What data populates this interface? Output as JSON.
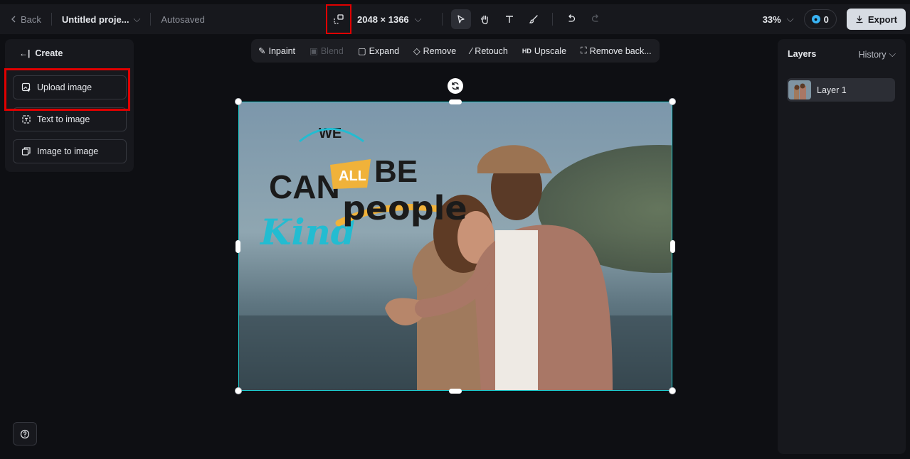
{
  "topbar": {
    "back_label": "Back",
    "project_title": "Untitled proje...",
    "autosave_status": "Autosaved",
    "canvas_size": "2048 × 1366",
    "zoom_level": "33%",
    "credits": "0",
    "export_label": "Export"
  },
  "left_panel": {
    "create_label": "Create",
    "upload_label": "Upload image",
    "text_to_image_label": "Text to image",
    "image_to_image_label": "Image to image"
  },
  "edit_toolbar": {
    "inpaint": "Inpaint",
    "blend": "Blend",
    "expand": "Expand",
    "remove": "Remove",
    "retouch": "Retouch",
    "upscale_badge": "HD",
    "upscale": "Upscale",
    "remove_bg": "Remove back..."
  },
  "canvas_text": {
    "we": "WE",
    "can": "CAN",
    "all": "ALL",
    "be": "BE",
    "kind": "Kind",
    "people": "people"
  },
  "right_panel": {
    "layers_tab": "Layers",
    "history_tab": "History",
    "layer_name": "Layer 1"
  },
  "colors": {
    "accent_cyan": "#1fd1d4",
    "highlight_red": "#e00000",
    "credit_blue": "#39b4f5"
  }
}
